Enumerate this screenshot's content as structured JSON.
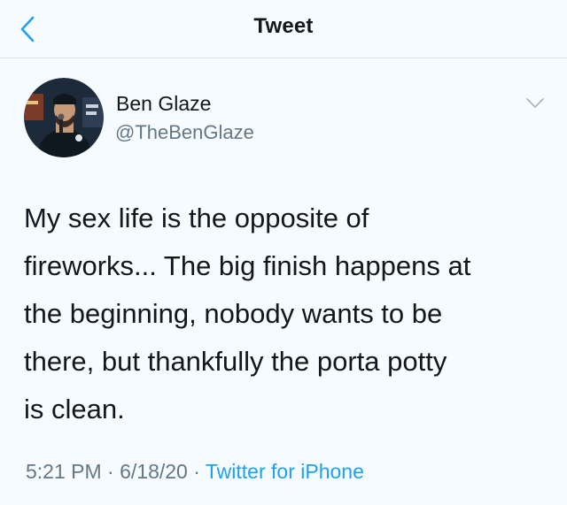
{
  "header": {
    "title": "Tweet",
    "back_icon": "chevron-left-icon",
    "accent_color": "#1da1f2"
  },
  "author": {
    "name": "Ben Glaze",
    "handle": "@TheBenGlaze",
    "avatar_icon": "profile-photo"
  },
  "menu": {
    "icon": "chevron-down-icon"
  },
  "tweet": {
    "lines": [
      "My sex life is the opposite of",
      "fireworks... The big finish happens at",
      "the beginning, nobody wants to be",
      "there, but thankfully the porta potty",
      "is clean."
    ]
  },
  "meta": {
    "time": "5:21 PM",
    "separator": " · ",
    "date": "6/18/20",
    "source": "Twitter for iPhone"
  }
}
